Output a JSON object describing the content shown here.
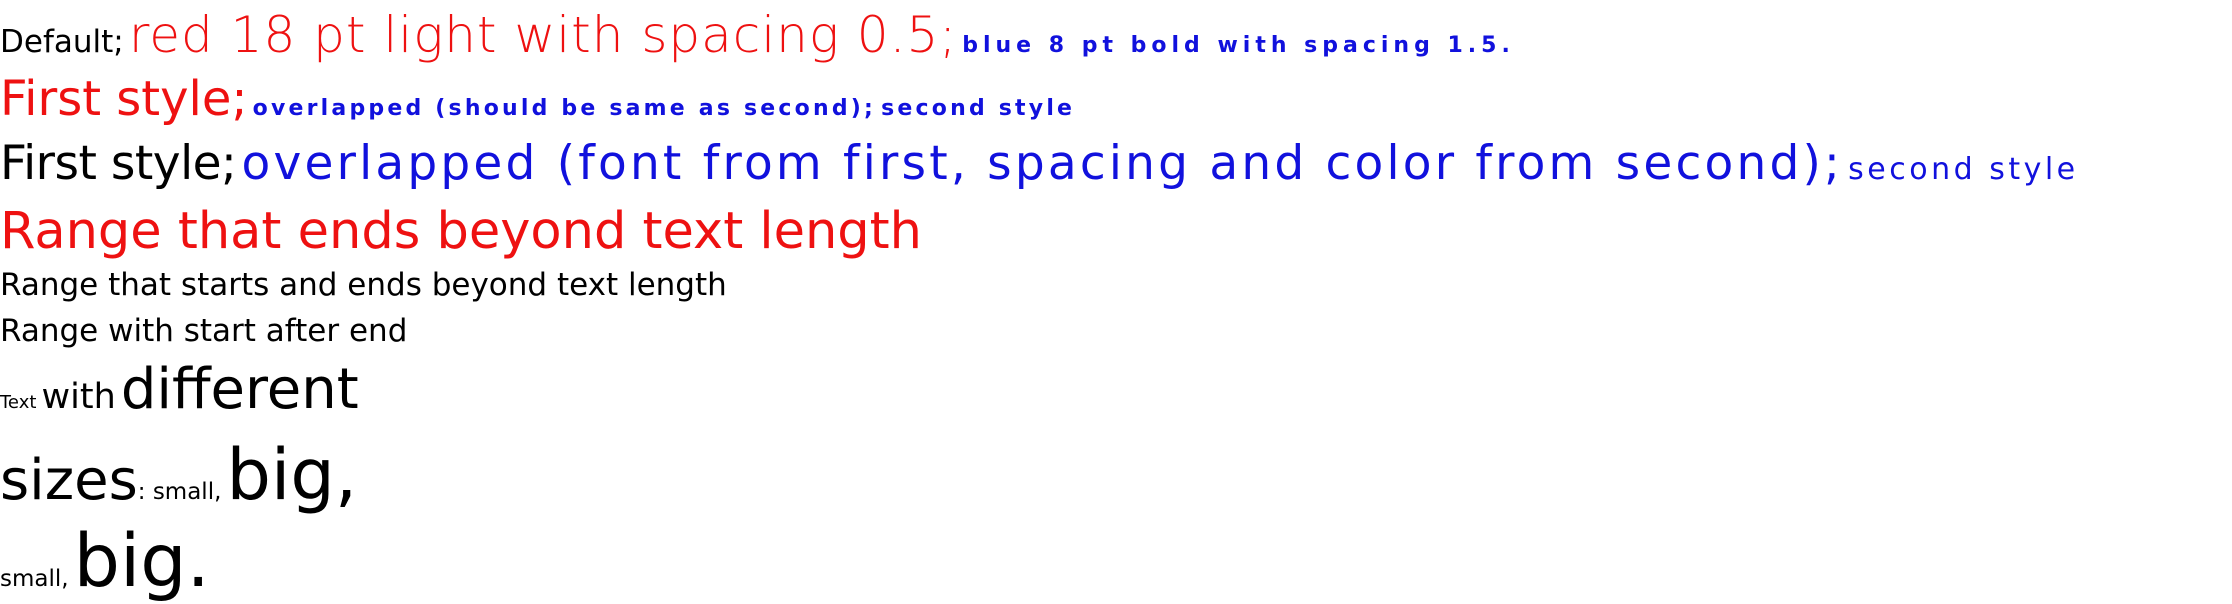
{
  "lines": {
    "l1": {
      "default_text": "Default;",
      "red_text": "red 18 pt light with spacing 0.5;",
      "blue_text": "blue 8 pt bold with spacing 1.5."
    },
    "l2": {
      "first_text": "First style;",
      "overlap_text": "overlapped (should be same as second);",
      "second_text": "second style"
    },
    "l3": {
      "first_text": "First style;",
      "overlap_text": "overlapped (font from first, spacing and color from second);",
      "second_text": "second style"
    },
    "l4": {
      "text": "Range that ends beyond text length"
    },
    "l5": {
      "text": "Range that starts and ends beyond text length"
    },
    "l6": {
      "text": "Range with start after end"
    },
    "l7": {
      "part1": "Text",
      "part2": "with",
      "part3": "different"
    },
    "l8": {
      "part1": "sizes",
      "part2": ": small,",
      "part3": "big,"
    },
    "l9": {
      "part1": "small,",
      "part2": "big."
    }
  },
  "colors": {
    "red": "#ee1111",
    "blue": "#1111dd",
    "black": "#000000"
  }
}
